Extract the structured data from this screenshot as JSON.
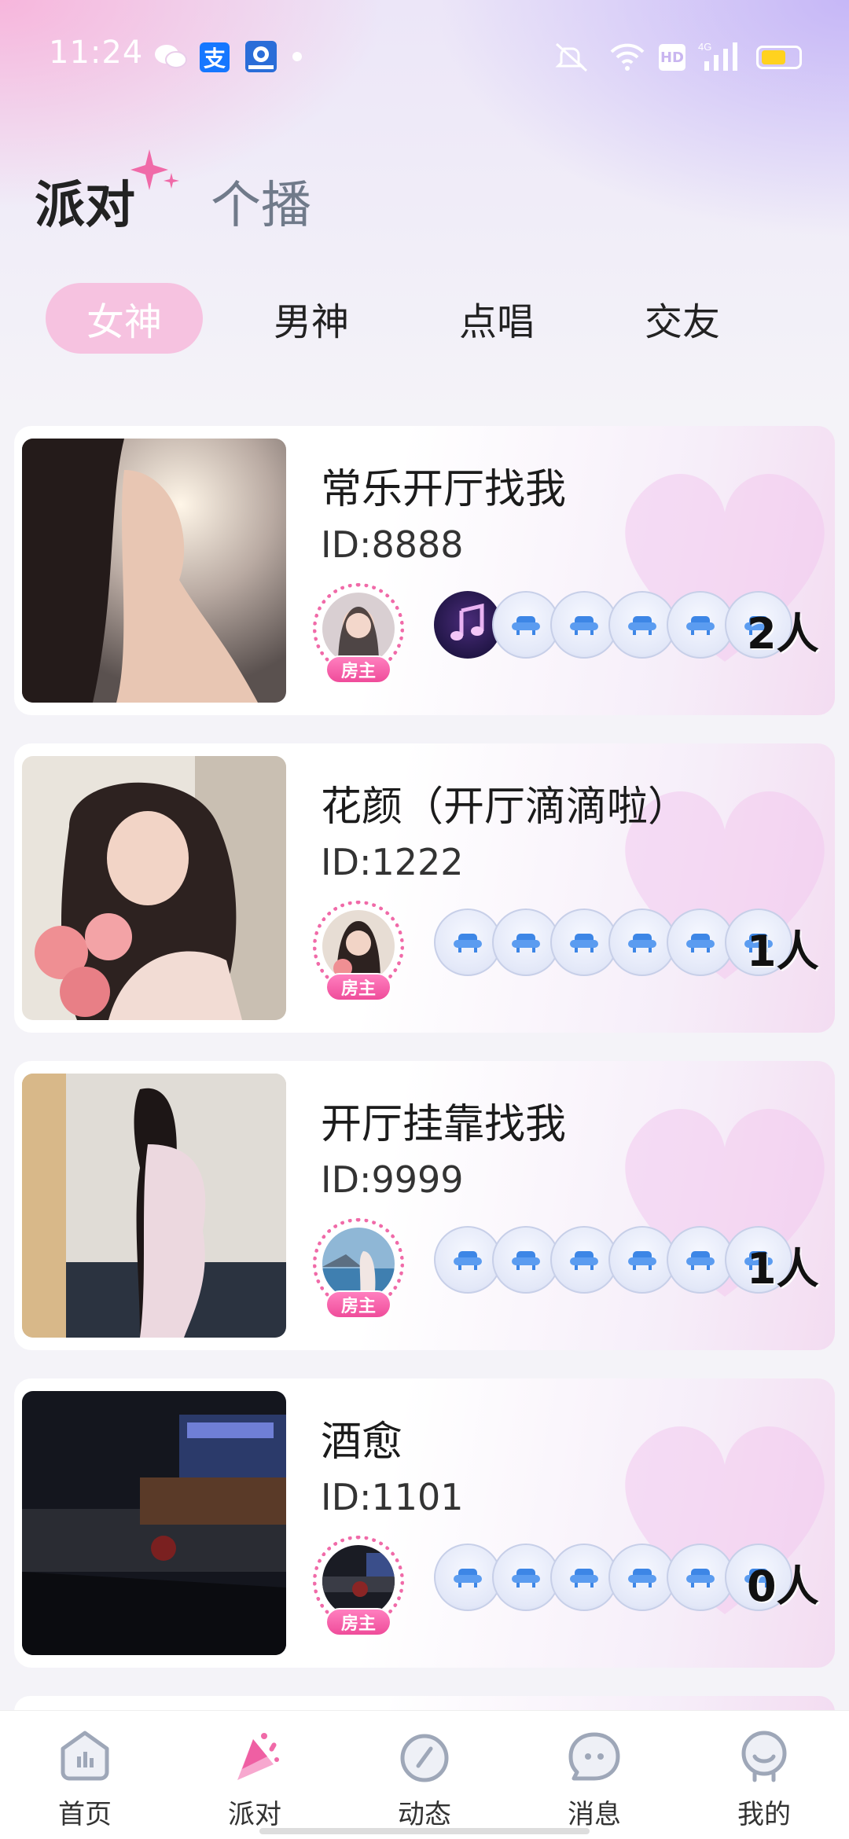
{
  "status_bar": {
    "time": "11:24",
    "alipay_glyph": "支",
    "hd_label": "HD",
    "network_label": "4G",
    "icons": [
      "wechat-icon",
      "alipay-icon",
      "app-icon",
      "mute-icon",
      "wifi-icon",
      "signal-icon",
      "battery-icon"
    ]
  },
  "header": {
    "tabs": [
      {
        "label": "派对",
        "active": true
      },
      {
        "label": "个播",
        "active": false
      }
    ]
  },
  "sub_tabs": [
    {
      "label": "女神",
      "active": true
    },
    {
      "label": "男神",
      "active": false
    },
    {
      "label": "点唱",
      "active": false
    },
    {
      "label": "交友",
      "active": false
    }
  ],
  "host_badge_label": "房主",
  "rooms": [
    {
      "title": "常乐开厅找我",
      "id": "ID:8888",
      "count": "2人",
      "has_music": true
    },
    {
      "title": "花颜（开厅滴滴啦）",
      "id": "ID:1222",
      "count": "1人",
      "has_music": false
    },
    {
      "title": "开厅挂靠找我",
      "id": "ID:9999",
      "count": "1人",
      "has_music": false
    },
    {
      "title": "酒愈",
      "id": "ID:1101",
      "count": "0人",
      "has_music": false
    }
  ],
  "bottom_nav": [
    {
      "label": "首页",
      "icon": "home-icon",
      "active": false
    },
    {
      "label": "派对",
      "icon": "party-icon",
      "active": true
    },
    {
      "label": "动态",
      "icon": "feed-icon",
      "active": false
    },
    {
      "label": "消息",
      "icon": "message-icon",
      "active": false
    },
    {
      "label": "我的",
      "icon": "profile-icon",
      "active": false
    }
  ],
  "colors": {
    "accent_pink": "#f06aa8",
    "active_tab_bg": "#f6c2e0",
    "seat_icon": "#3d86e6"
  }
}
